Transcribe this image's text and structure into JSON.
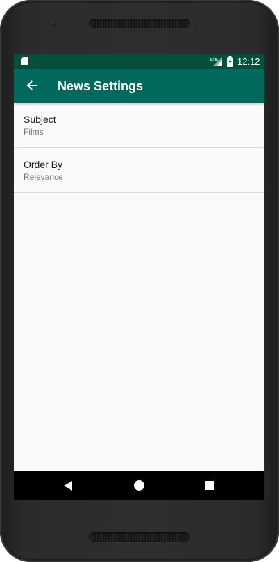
{
  "status_bar": {
    "time": "12:12",
    "network_label": "LTE",
    "icons": [
      "sd-card-icon",
      "signal-icon",
      "battery-charging-icon"
    ]
  },
  "app_bar": {
    "title": "News Settings",
    "back_icon": "arrow-back-icon",
    "color": "#00695c",
    "status_color": "#00503c"
  },
  "preferences": [
    {
      "title": "Subject",
      "summary": "Films"
    },
    {
      "title": "Order By",
      "summary": "Relevance"
    }
  ],
  "nav_bar": {
    "buttons": [
      "back-triangle-icon",
      "home-circle-icon",
      "recents-square-icon"
    ]
  }
}
